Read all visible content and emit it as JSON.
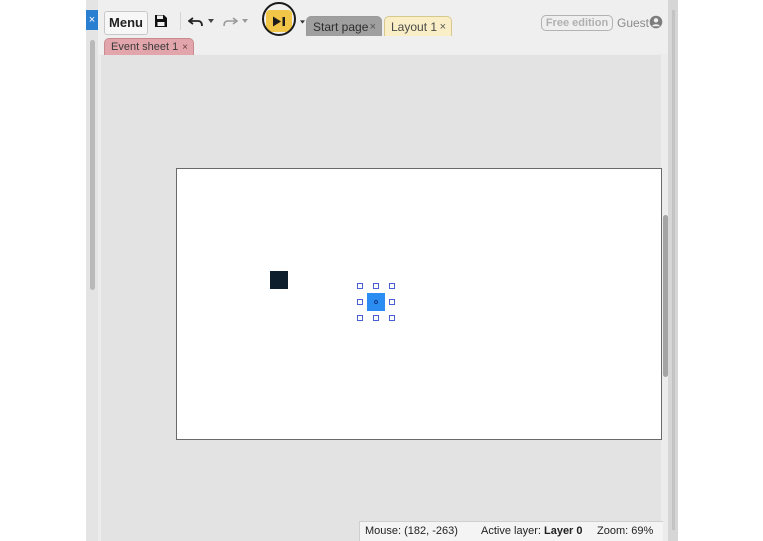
{
  "toolbar": {
    "menu_label": "Menu",
    "save_icon": "floppy-disk-icon",
    "undo_icon": "undo-arrow-icon",
    "redo_icon": "redo-arrow-icon",
    "preview_icon": "play-preview-icon",
    "preview_color": "#f1c648"
  },
  "tabs": [
    {
      "label": "Start page",
      "close": "×"
    },
    {
      "label": "Layout 1",
      "close": "×"
    }
  ],
  "sub_tabs": [
    {
      "label": "Event sheet 1",
      "close": "×",
      "color": "#e2a5ab"
    }
  ],
  "account": {
    "edition": "Free edition",
    "user": "Guest",
    "user_icon": "user-avatar-icon"
  },
  "window_close": "×",
  "layout": {
    "background": "#ffffff",
    "objects": [
      {
        "name": "dark-sprite",
        "color": "#0d1f2d"
      },
      {
        "name": "blue-sprite",
        "color": "#2b8cf2",
        "selected": true
      }
    ]
  },
  "status": {
    "mouse_label": "Mouse:",
    "mouse_value": "(182, -263)",
    "layer_label": "Active layer:",
    "layer_value": "Layer 0",
    "zoom_label": "Zoom:",
    "zoom_value": "69%"
  }
}
